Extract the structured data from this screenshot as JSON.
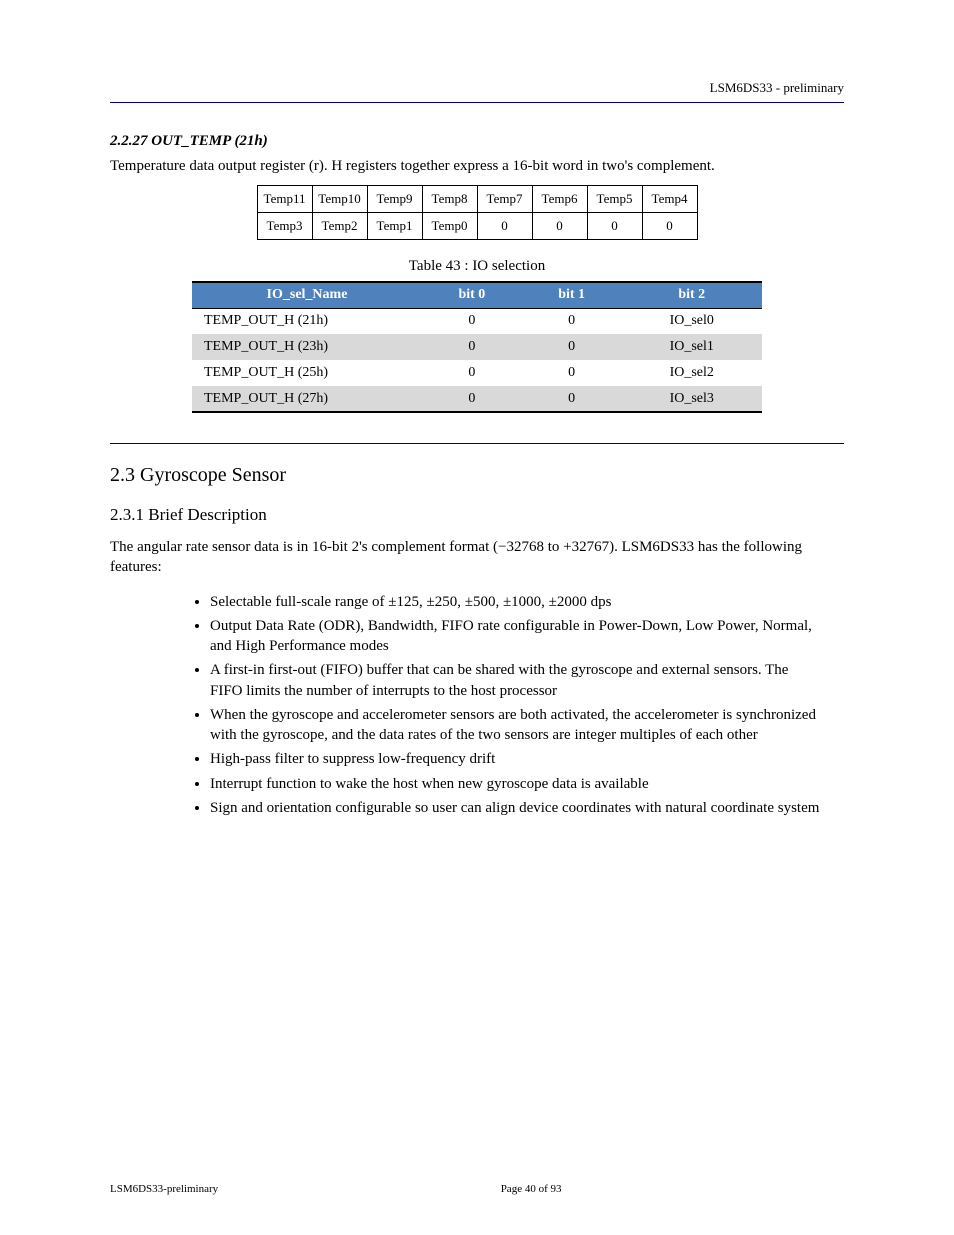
{
  "header": {
    "doc_title": "LSM6DS33 - preliminary"
  },
  "section1": {
    "num": "2.2.27",
    "title": "OUT_TEMP (21h)",
    "subtitle": "Temperature data output register (r). H registers together express a 16-bit word in two's complement.",
    "bit_row1": [
      "Temp11",
      "Temp10",
      "Temp9",
      "Temp8",
      "Temp7",
      "Temp6",
      "Temp5",
      "Temp4"
    ],
    "bit_row2": [
      "Temp3",
      "Temp2",
      "Temp1",
      "Temp0",
      "0",
      "0",
      "0",
      "0"
    ]
  },
  "io_table": {
    "caption": "Table 43 : IO selection",
    "headers": [
      "IO_sel_Name",
      "bit 0",
      "bit 1",
      "bit 2"
    ],
    "rows": [
      [
        "TEMP_OUT_H (21h)",
        "0",
        "0",
        "IO_sel0"
      ],
      [
        "TEMP_OUT_H (23h)",
        "0",
        "0",
        "IO_sel1"
      ],
      [
        "TEMP_OUT_H (25h)",
        "0",
        "0",
        "IO_sel2"
      ],
      [
        "TEMP_OUT_H (27h)",
        "0",
        "0",
        "IO_sel3"
      ]
    ]
  },
  "section2": {
    "num": "2.3",
    "title": "Gyroscope Sensor",
    "sub_num": "2.3.1",
    "sub_title": "Brief Description",
    "para": "The angular rate sensor data is in 16-bit 2's complement format (−32768 to +32767). LSM6DS33 has the following features:",
    "bullets": [
      "Selectable full-scale range of ±125, ±250, ±500, ±1000, ±2000 dps",
      "Output Data Rate (ODR), Bandwidth, FIFO rate configurable in Power-Down, Low Power, Normal, and High Performance modes",
      "A first-in first-out (FIFO) buffer that can be shared with the gyroscope and external sensors. The FIFO limits the number of interrupts to the host processor",
      "When the gyroscope and accelerometer sensors are both activated, the accelerometer is synchronized with the gyroscope, and the data rates of the two sensors are integer multiples of each other",
      "High-pass filter to suppress low-frequency drift",
      "Interrupt function to wake the host when new gyroscope data is available",
      "Sign and orientation configurable so user can align device coordinates with natural coordinate system"
    ]
  },
  "footer": {
    "left": "LSM6DS33-preliminary",
    "center": "Page 40 of 93",
    "right": ""
  }
}
